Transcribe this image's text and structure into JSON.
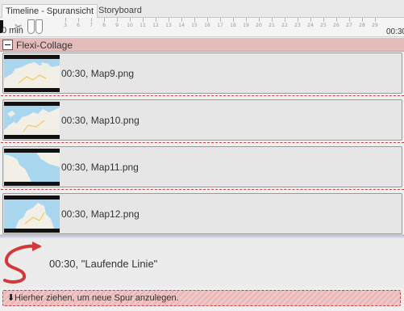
{
  "tabs": [
    {
      "label": "Timeline - Spuransicht",
      "active": true
    },
    {
      "label": "Storyboard",
      "active": false
    }
  ],
  "ruler": {
    "start_label": "0 min",
    "end_label": "00:30",
    "ticks": [
      "3",
      "6",
      "7",
      "8",
      "9",
      "10",
      "11",
      "12",
      "13",
      "14",
      "15",
      "16",
      "17",
      "18",
      "19",
      "20",
      "21",
      "22",
      "23",
      "24",
      "25",
      "26",
      "27",
      "28",
      "29"
    ]
  },
  "group": {
    "title": "Flexi-Collage",
    "collapsed": false
  },
  "clips": [
    {
      "label": "00:30, Map9.png",
      "icon": "map-thumbnail-icon"
    },
    {
      "label": "00:30, Map10.png",
      "icon": "map-thumbnail-icon"
    },
    {
      "label": "00:30, Map11.png",
      "icon": "map-thumbnail-icon"
    },
    {
      "label": "00:30, Map12.png",
      "icon": "map-thumbnail-icon"
    }
  ],
  "animation": {
    "label": "00:30, \"Laufende Linie\"",
    "icon": "running-line-icon",
    "color": "#d23a3a"
  },
  "dropzone": {
    "label": "Hierher ziehen, um neue Spur anzulegen.",
    "icon": "arrow-down-icon"
  },
  "colors": {
    "group_header": "#e4bcbc",
    "dropzone": "#f0c7c7",
    "accent_red": "#c04848",
    "map_water": "#a9d6ef",
    "map_land": "#f2efe7"
  }
}
